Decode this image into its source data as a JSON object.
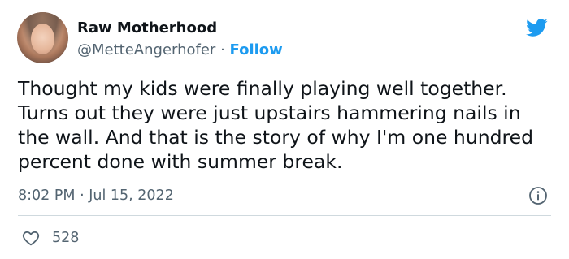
{
  "user": {
    "display_name": "Raw Motherhood",
    "handle": "@MetteAngerhofer",
    "separator": " · ",
    "follow_label": "Follow"
  },
  "tweet": {
    "text": "Thought my kids were finally playing well together. Turns out they were just upstairs hammering nails in the wall. And that is the story of why I'm one hundred percent done with summer break.",
    "time": "8:02 PM",
    "date_separator": " · ",
    "date": "Jul 15, 2022",
    "like_count": "528"
  },
  "icons": {
    "brand": "twitter-bird-icon",
    "info": "info-icon",
    "like": "heart-icon"
  },
  "colors": {
    "accent": "#1d9bf0",
    "text": "#0f1419",
    "secondary": "#536471",
    "divider": "#cfd9de"
  }
}
